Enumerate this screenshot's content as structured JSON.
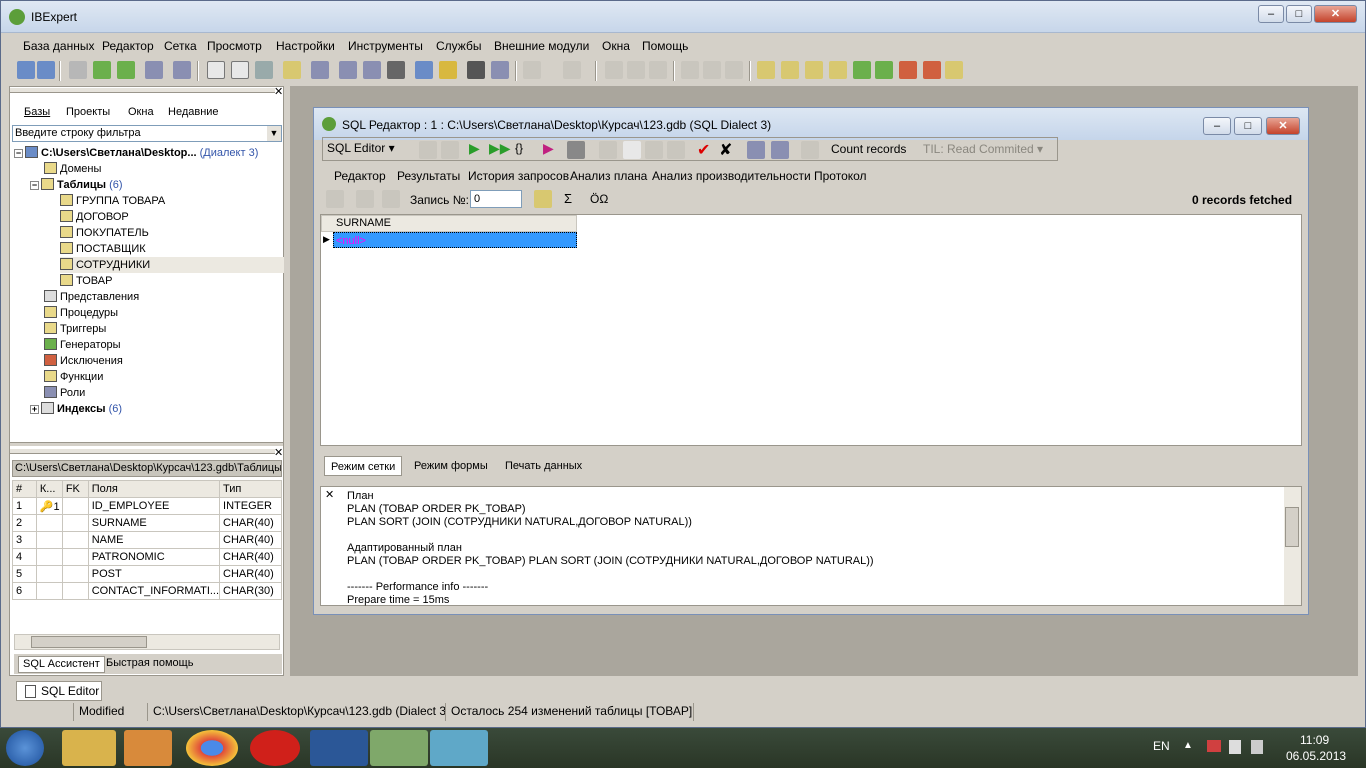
{
  "app": {
    "title": "IBExpert"
  },
  "window_controls": {
    "minimize": "–",
    "restore": "□",
    "close": "✕"
  },
  "menu": [
    "База данных",
    "Редактор",
    "Сетка",
    "Просмотр",
    "Настройки",
    "Инструменты",
    "Службы",
    "Внешние модули",
    "Окна",
    "Помощь"
  ],
  "left_panel": {
    "tabs": [
      "Базы",
      "Проекты",
      "Окна",
      "Недавние"
    ],
    "filter_placeholder": "Введите строку фильтра",
    "tree": {
      "root": "C:\\Users\\Светлана\\Desktop...",
      "root_dialect": "(Диалект 3)",
      "domains": "Домены",
      "tables": "Таблицы",
      "tables_count": "(6)",
      "table_items": [
        "ГРУППА ТОВАРА",
        "ДОГОВОР",
        "ПОКУПАТЕЛЬ",
        "ПОСТАВЩИК",
        "СОТРУДНИКИ",
        "ТОВАР"
      ],
      "other_items": [
        "Представления",
        "Процедуры",
        "Триггеры",
        "Генераторы",
        "Исключения",
        "Функции",
        "Роли"
      ],
      "indexes": "Индексы",
      "indexes_count": "(6)"
    }
  },
  "props_panel": {
    "header": "C:\\Users\\Светлана\\Desktop\\Курсач\\123.gdb\\Таблицы\\СОТРУДНИКИ",
    "columns": [
      "#",
      "К...",
      "FK",
      "Поля",
      "Тип"
    ],
    "rows": [
      {
        "n": "1",
        "key": "🔑1",
        "fk": "",
        "field": "ID_EMPLOYEE",
        "type": "INTEGER"
      },
      {
        "n": "2",
        "key": "",
        "fk": "",
        "field": "SURNAME",
        "type": "CHAR(40)"
      },
      {
        "n": "3",
        "key": "",
        "fk": "",
        "field": "NAME",
        "type": "CHAR(40)"
      },
      {
        "n": "4",
        "key": "",
        "fk": "",
        "field": "PATRONOMIC",
        "type": "CHAR(40)"
      },
      {
        "n": "5",
        "key": "",
        "fk": "",
        "field": "POST",
        "type": "CHAR(40)"
      },
      {
        "n": "6",
        "key": "",
        "fk": "",
        "field": "CONTACT_INFORMATI...",
        "type": "CHAR(30)"
      }
    ],
    "bottom_tabs": [
      "SQL Ассистент",
      "Быстрая помощь"
    ]
  },
  "sql_window": {
    "title": "SQL Редактор : 1 : C:\\Users\\Светлана\\Desktop\\Курсач\\123.gdb (SQL Dialect 3)",
    "sql_editor_btn": "SQL Editor",
    "count_records": "Count records",
    "til": "TIL: Read Commited",
    "tabs": [
      "Редактор",
      "Результаты",
      "История запросов",
      "Анализ плана",
      "Анализ производительности",
      "Протокол"
    ],
    "record_label": "Запись №:",
    "record_value": "0",
    "records_fetched": "0 records fetched",
    "grid_header": "SURNAME",
    "grid_cell": "<null>",
    "bottom_tabs": [
      "Режим сетки",
      "Режим формы",
      "Печать данных"
    ],
    "plan_text": "План\nPLAN (ТОВАР ORDER PK_ТОВАР)\nPLAN SORT (JOIN (СОТРУДНИКИ NATURAL,ДОГОВОР NATURAL))\n\nАдаптированный план\nPLAN (ТОВАР ORDER PK_ТОВАР) PLAN SORT (JOIN (СОТРУДНИКИ NATURAL,ДОГОВОР NATURAL))\n\n------- Performance info -------\nPrepare time = 15ms"
  },
  "doc_tab": "SQL Editor",
  "status": {
    "state": "Modified",
    "path": "C:\\Users\\Светлана\\Desktop\\Курсач\\123.gdb (Dialect 3)",
    "changes": "Осталось 254 изменений таблицы [ТОВАР]"
  },
  "taskbar": {
    "lang": "EN",
    "time": "11:09",
    "date": "06.05.2013"
  }
}
